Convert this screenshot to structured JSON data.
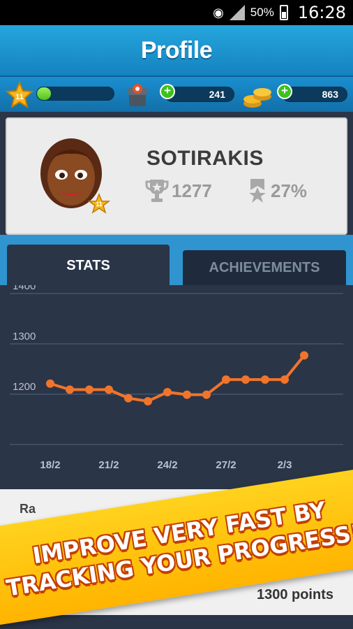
{
  "status_bar": {
    "battery": "50%",
    "time": "16:28"
  },
  "header": {
    "title": "Profile"
  },
  "resources": {
    "level": "11",
    "xp_progress": 0.18,
    "chests": "241",
    "coins": "863"
  },
  "profile": {
    "username": "SOTIRAKIS",
    "avatar_level": "11",
    "trophies": "1277",
    "achievement_percent": "27%"
  },
  "tabs": [
    {
      "label": "STATS",
      "active": true
    },
    {
      "label": "ACHIEVEMENTS",
      "active": false
    }
  ],
  "chart_data": {
    "type": "line",
    "y_tick_labels": [
      "1400",
      "1300",
      "1200"
    ],
    "x_tick_labels": [
      "18/2",
      "21/2",
      "24/2",
      "27/2",
      "2/3"
    ],
    "x_tick_index": [
      0,
      3,
      6,
      9,
      12
    ],
    "ylim": [
      1100,
      1400
    ],
    "grid": true,
    "series": [
      {
        "color": "#f0752b",
        "values": [
          1221,
          1209,
          1209,
          1209,
          1192,
          1186,
          1204,
          1199,
          1199,
          1229,
          1229,
          1229,
          1229,
          1277
        ]
      }
    ]
  },
  "lower": {
    "partial_label": "Ra",
    "points": "1300 points"
  },
  "banner": {
    "line1": "IMPROVE VERY FAST BY",
    "line2": "TRACKING YOUR PROGRESS!"
  }
}
